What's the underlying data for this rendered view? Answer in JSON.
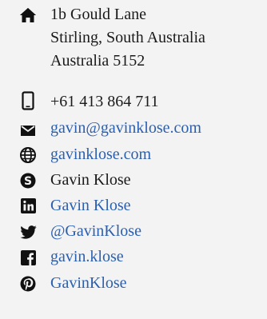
{
  "contact": {
    "address_lines": [
      "1b Gould Lane",
      "Stirling, South Australia",
      "Australia 5152"
    ],
    "phone": "+61 413 864 711",
    "email": "gavin@gavinklose.com",
    "website": "gavinklose.com",
    "skype": "Gavin Klose",
    "linkedin": "Gavin Klose",
    "twitter": "@GavinKlose",
    "facebook": "gavin.klose",
    "pinterest": "GavinKlose"
  },
  "colors": {
    "link": "#2a5fb0",
    "text": "#1a1a1a",
    "icon": "#111111",
    "background": "#f3f3f3"
  },
  "icons": [
    "home-icon",
    "mobile-phone-icon",
    "envelope-icon",
    "globe-icon",
    "skype-icon",
    "linkedin-icon",
    "twitter-icon",
    "facebook-icon",
    "pinterest-icon"
  ]
}
